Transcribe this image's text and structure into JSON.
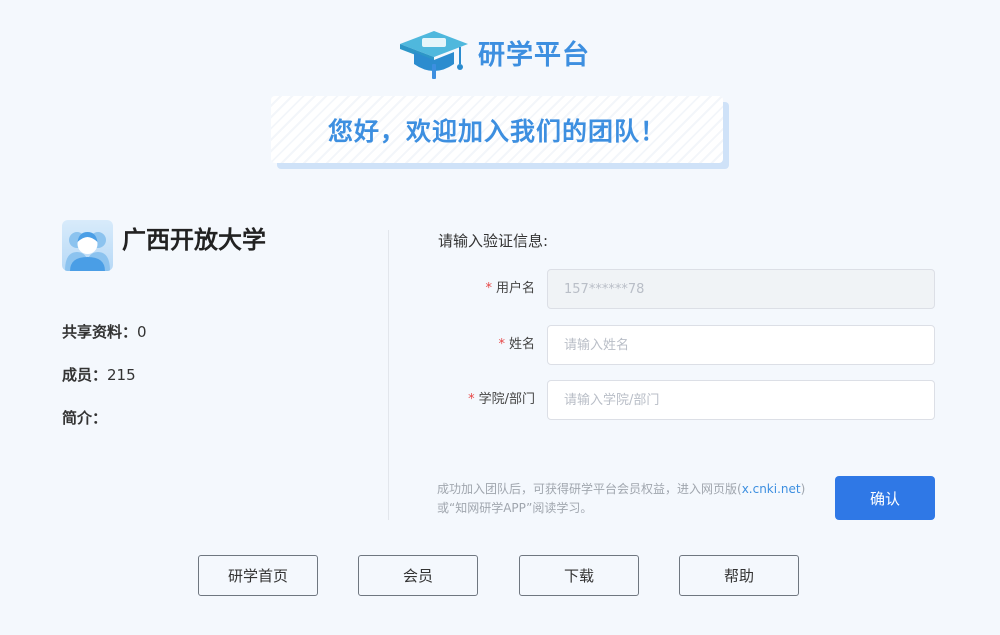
{
  "header": {
    "logo_text": "研学平台",
    "banner_text": "您好，欢迎加入我们的团队！"
  },
  "team": {
    "name": "广西开放大学",
    "shared_label": "共享资料：",
    "shared_value": "0",
    "members_label": "成员：",
    "members_value": "215",
    "intro_label": "简介："
  },
  "form": {
    "title": "请输入验证信息:",
    "required_mark": "*",
    "username": {
      "label": "用户名",
      "value": "157******78"
    },
    "name": {
      "label": "姓名",
      "placeholder": "请输入姓名"
    },
    "department": {
      "label": "学院/部门",
      "placeholder": "请输入学院/部门"
    },
    "notice_before": "成功加入团队后，可获得研学平台会员权益，进入网页版(",
    "notice_link": "x.cnki.net",
    "notice_after": ")或“知网研学APP”阅读学习。",
    "confirm_label": "确认"
  },
  "footer": {
    "home": "研学首页",
    "member": "会员",
    "download": "下载",
    "help": "帮助"
  },
  "colors": {
    "brand_blue": "#3d8fe0",
    "button_blue": "#2f78e6",
    "required_red": "#e64545",
    "page_bg": "#f4f8fd"
  },
  "icons": {
    "logo": "graduation-cap-icon",
    "avatar": "team-avatar-icon"
  }
}
